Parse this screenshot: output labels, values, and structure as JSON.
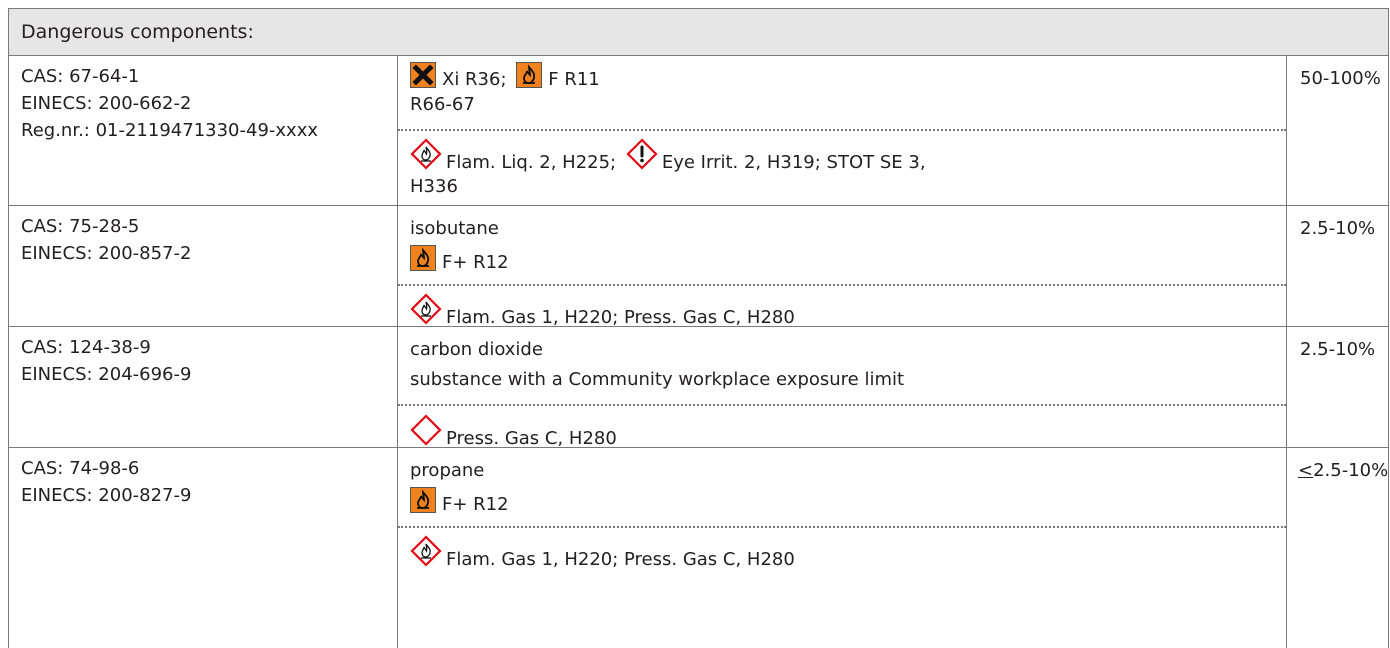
{
  "header": {
    "title": "Dangerous components:"
  },
  "rows": [
    {
      "ids": [
        "CAS: 67-64-1",
        "EINECS: 200-662-2",
        "Reg.nr.: 01-2119471330-49-xxxx"
      ],
      "dsd_line1": [
        {
          "icon": "harmful-x-icon",
          "text": "Xi R36;"
        },
        {
          "icon": "flame-icon",
          "text": "F R11"
        }
      ],
      "dsd_line2": "R66-67",
      "clp_line1": [
        {
          "icon": "ghs-flame-icon",
          "text": "Flam. Liq. 2, H225;"
        },
        {
          "icon": "ghs-exclamation-icon",
          "text": "Eye Irrit. 2, H319; STOT SE 3,"
        }
      ],
      "clp_line2": "H336",
      "conc": "50-100%"
    },
    {
      "ids": [
        "CAS: 75-28-5",
        "EINECS: 200-857-2"
      ],
      "name": "isobutane",
      "dsd": [
        {
          "icon": "flame-icon",
          "text": "F+ R12"
        }
      ],
      "clp": [
        {
          "icon": "ghs-flame-icon",
          "text": "Flam. Gas 1, H220; Press. Gas C, H280"
        }
      ],
      "conc": "2.5-10%"
    },
    {
      "ids": [
        "CAS: 124-38-9",
        "EINECS: 204-696-9"
      ],
      "name": "carbon dioxide",
      "note": "substance with a Community workplace exposure limit",
      "clp": [
        {
          "icon": "ghs-empty-diamond-icon",
          "text": "Press. Gas C, H280"
        }
      ],
      "conc": "2.5-10%"
    },
    {
      "ids": [
        "CAS: 74-98-6",
        "EINECS: 200-827-9"
      ],
      "name": "propane",
      "dsd": [
        {
          "icon": "flame-icon",
          "text": "F+ R12"
        }
      ],
      "clp": [
        {
          "icon": "ghs-flame-icon",
          "text": "Flam. Gas 1, H220; Press. Gas C, H280"
        }
      ],
      "conc_prefix": "<",
      "conc": "2.5-10%"
    }
  ],
  "colors": {
    "border": "#7a7a7a",
    "header_bg": "#e6e6e6",
    "dsd_orange": "#f0821e",
    "ghs_red": "#e30613"
  }
}
